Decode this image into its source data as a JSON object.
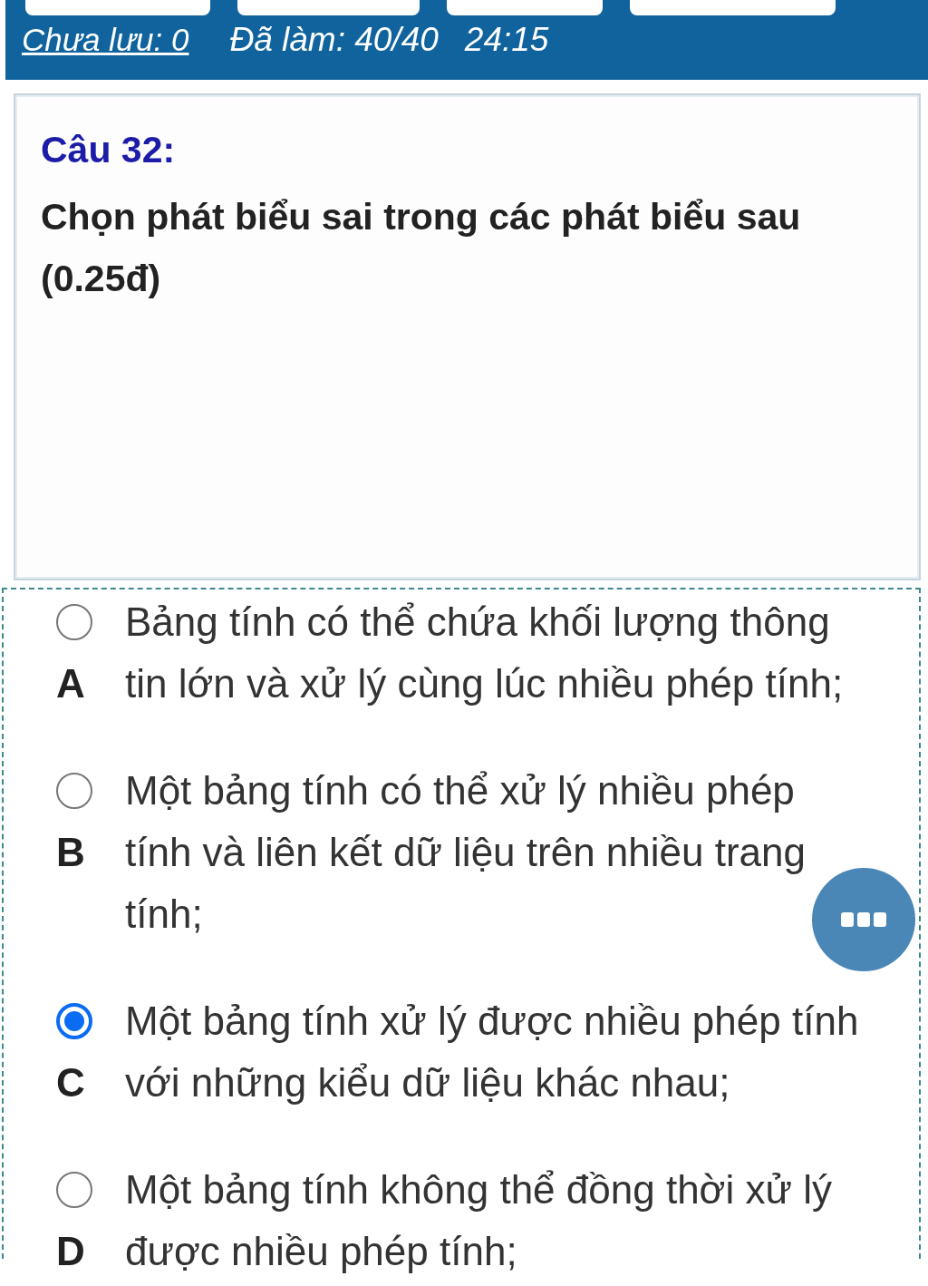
{
  "status_bar": {
    "unsaved": "Chưa lưu: 0",
    "done": "Đã làm: 40/40",
    "timer": "24:15"
  },
  "question": {
    "number": "Câu 32:",
    "text": "Chọn phát biểu sai trong các phát biểu sau\n(0.25đ)"
  },
  "options": [
    {
      "letter": "A",
      "text": "Bảng tính có thể chứa khối lượng thông\ntin lớn và xử lý cùng lúc nhiều phép tính;",
      "selected": false
    },
    {
      "letter": "B",
      "text": "Một bảng tính có thể xử lý nhiều phép\ntính và liên kết dữ liệu trên nhiều trang\ntính;",
      "selected": false
    },
    {
      "letter": "C",
      "text": "Một bảng tính xử lý được nhiều phép tính\nvới những kiểu dữ liệu khác nhau;",
      "selected": true
    },
    {
      "letter": "D",
      "text": "Một bảng tính không thể đồng thời xử lý\nđược nhiều phép tính;",
      "selected": false
    }
  ]
}
